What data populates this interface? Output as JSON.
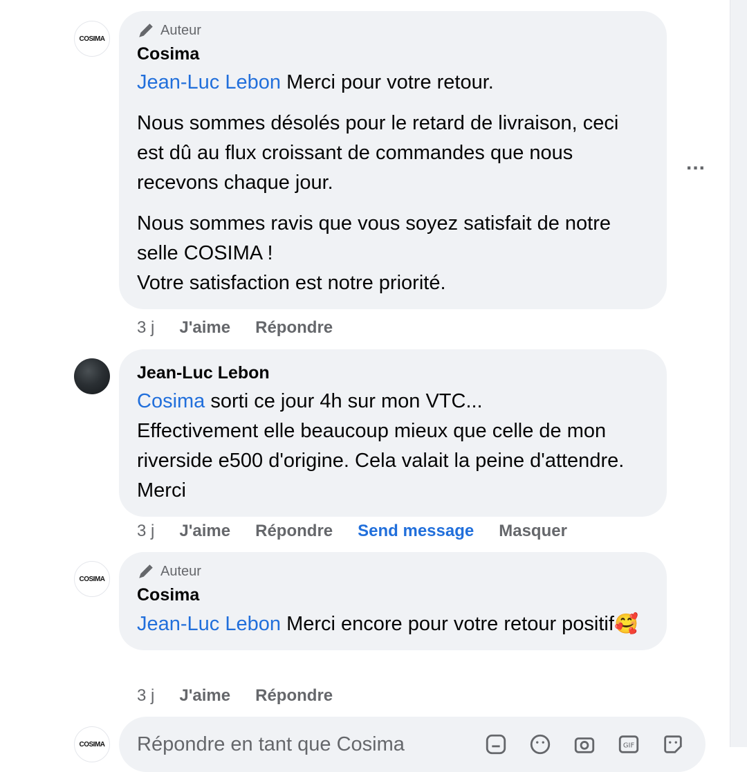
{
  "comments": [
    {
      "badge": "Auteur",
      "author": "Cosima",
      "avatar_text": "COSIMA",
      "mention": "Jean-Luc Lebon",
      "first_line": "Merci pour votre retour.",
      "paragraph2": "Nous sommes désolés pour le retard de livraison, ceci est dû au flux croissant de commandes que nous recevons chaque jour.",
      "paragraph3_line1": "Nous sommes ravis que vous soyez satisfait de notre selle COSIMA !",
      "paragraph3_line2": "Votre satisfaction est notre priorité.",
      "time": "3 j",
      "like": "J'aime",
      "reply": "Répondre"
    },
    {
      "author": "Jean-Luc Lebon",
      "mention": "Cosima",
      "first_line": "sorti ce jour 4h sur mon VTC...",
      "body": "Effectivement elle beaucoup mieux que celle de mon riverside e500 d'origine. Cela valait la peine d'attendre. Merci",
      "time": "3 j",
      "like": "J'aime",
      "reply": "Répondre",
      "send_message": "Send message",
      "hide": "Masquer"
    },
    {
      "badge": "Auteur",
      "author": "Cosima",
      "avatar_text": "COSIMA",
      "mention": "Jean-Luc Lebon",
      "text": "Merci encore pour votre retour positif",
      "emoji": "🥰",
      "time": "3 j",
      "like": "J'aime",
      "reply": "Répondre"
    }
  ],
  "more_options": "...",
  "reply_box": {
    "avatar_text": "COSIMA",
    "placeholder": "Répondre en tant que Cosima",
    "icons": [
      "sticker-icon",
      "emoji-icon",
      "camera-icon",
      "gif-icon",
      "sticker-face-icon"
    ]
  },
  "colors": {
    "bubble": "#f0f2f5",
    "link": "#216fdb",
    "secondary_text": "#65676b"
  }
}
